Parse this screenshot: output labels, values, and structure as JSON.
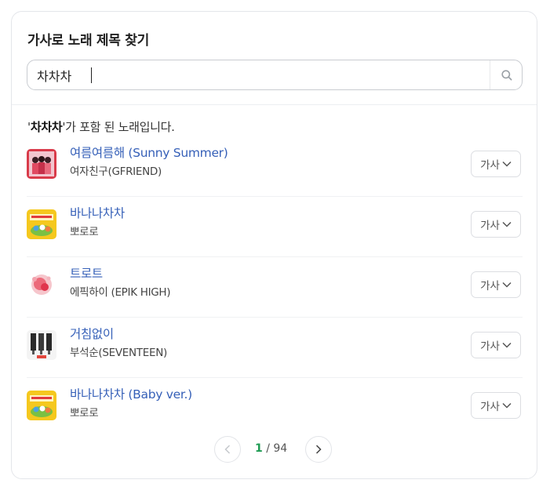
{
  "panel": {
    "title": "가사로 노래 제목 찾기"
  },
  "search": {
    "value": "차차차",
    "placeholder": ""
  },
  "result": {
    "keyword": "차차차",
    "suffix": "가 포함 된 노래입니다."
  },
  "songs": [
    {
      "title": "여름여름해 (Sunny Summer)",
      "artist": "여자친구(GFRIEND)",
      "button": "가사"
    },
    {
      "title": "바나나차차",
      "artist": "뽀로로",
      "button": "가사"
    },
    {
      "title": "트로트",
      "artist": "에픽하이 (EPIK HIGH)",
      "button": "가사"
    },
    {
      "title": "거침없이",
      "artist": "부석순(SEVENTEEN)",
      "button": "가사"
    },
    {
      "title": "바나나차차 (Baby ver.)",
      "artist": "뽀로로",
      "button": "가사"
    }
  ],
  "pagination": {
    "current": "1",
    "separator": "/",
    "total": "94"
  },
  "colors": {
    "song_link": "#3660b8",
    "current_page": "#1d9b52"
  }
}
